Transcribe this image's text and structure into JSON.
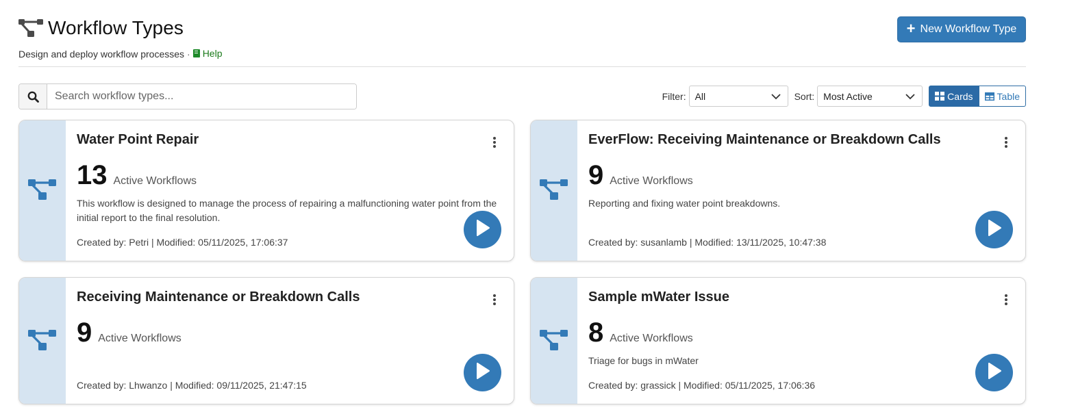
{
  "header": {
    "title": "Workflow Types",
    "subtitle": "Design and deploy workflow processes",
    "separator": "·",
    "help_label": "Help",
    "new_button_label": "New Workflow Type"
  },
  "search": {
    "placeholder": "Search workflow types...",
    "value": ""
  },
  "controls": {
    "filter_label": "Filter:",
    "filter_value": "All",
    "sort_label": "Sort:",
    "sort_value": "Most Active",
    "view_cards_label": "Cards",
    "view_table_label": "Table",
    "active_view": "Cards"
  },
  "colors": {
    "primary": "#337ab7",
    "card_side": "#d6e4f1",
    "help_green": "#1e8a2a"
  },
  "icons": {
    "title": "workflow-icon",
    "search": "search-icon",
    "plus": "plus-icon",
    "chevron": "chevron-down-icon",
    "cards": "grid-icon",
    "table": "table-icon",
    "menu": "kebab-menu-icon",
    "play": "play-icon",
    "help": "book-icon"
  },
  "cards": [
    {
      "title": "Water Point Repair",
      "count": "13",
      "count_label": "Active Workflows",
      "description": "This workflow is designed to manage the process of repairing a malfunctioning water point from the initial report to the final resolution.",
      "meta": "Created by: Petri | Modified: 05/11/2025, 17:06:37"
    },
    {
      "title": "EverFlow: Receiving Maintenance or Breakdown Calls",
      "count": "9",
      "count_label": "Active Workflows",
      "description": "Reporting and fixing water point breakdowns.",
      "meta": "Created by: susanlamb | Modified: 13/11/2025, 10:47:38"
    },
    {
      "title": "Receiving Maintenance or Breakdown Calls",
      "count": "9",
      "count_label": "Active Workflows",
      "description": "",
      "meta": "Created by: Lhwanzo | Modified: 09/11/2025, 21:47:15"
    },
    {
      "title": "Sample mWater Issue",
      "count": "8",
      "count_label": "Active Workflows",
      "description": "Triage for bugs in mWater",
      "meta": "Created by: grassick | Modified: 05/11/2025, 17:06:36"
    }
  ]
}
